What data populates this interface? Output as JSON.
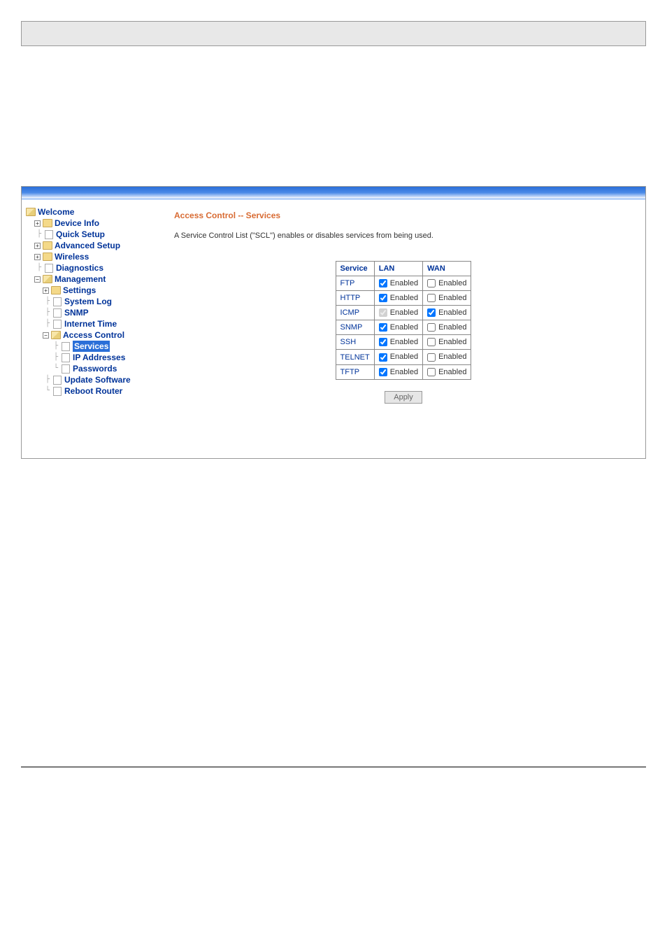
{
  "nav": {
    "welcome": "Welcome",
    "device_info": "Device Info",
    "quick_setup": "Quick Setup",
    "advanced_setup": "Advanced Setup",
    "wireless": "Wireless",
    "diagnostics": "Diagnostics",
    "management": "Management",
    "settings": "Settings",
    "system_log": "System Log",
    "snmp": "SNMP",
    "internet_time": "Internet Time",
    "access_control": "Access Control",
    "services": "Services",
    "ip_addresses": "IP Addresses",
    "passwords": "Passwords",
    "update_software": "Update Software",
    "reboot_router": "Reboot Router"
  },
  "content": {
    "title": "Access Control -- Services",
    "description": "A Service Control List (\"SCL\") enables or disables services from being used.",
    "apply_label": "Apply",
    "table": {
      "headers": {
        "service": "Service",
        "lan": "LAN",
        "wan": "WAN"
      },
      "enabled_label": "Enabled",
      "rows": [
        {
          "service": "FTP",
          "lan_checked": true,
          "lan_disabled": false,
          "wan_checked": false
        },
        {
          "service": "HTTP",
          "lan_checked": true,
          "lan_disabled": false,
          "wan_checked": false
        },
        {
          "service": "ICMP",
          "lan_checked": true,
          "lan_disabled": true,
          "wan_checked": true
        },
        {
          "service": "SNMP",
          "lan_checked": true,
          "lan_disabled": false,
          "wan_checked": false
        },
        {
          "service": "SSH",
          "lan_checked": true,
          "lan_disabled": false,
          "wan_checked": false
        },
        {
          "service": "TELNET",
          "lan_checked": true,
          "lan_disabled": false,
          "wan_checked": false
        },
        {
          "service": "TFTP",
          "lan_checked": true,
          "lan_disabled": false,
          "wan_checked": false
        }
      ]
    }
  }
}
